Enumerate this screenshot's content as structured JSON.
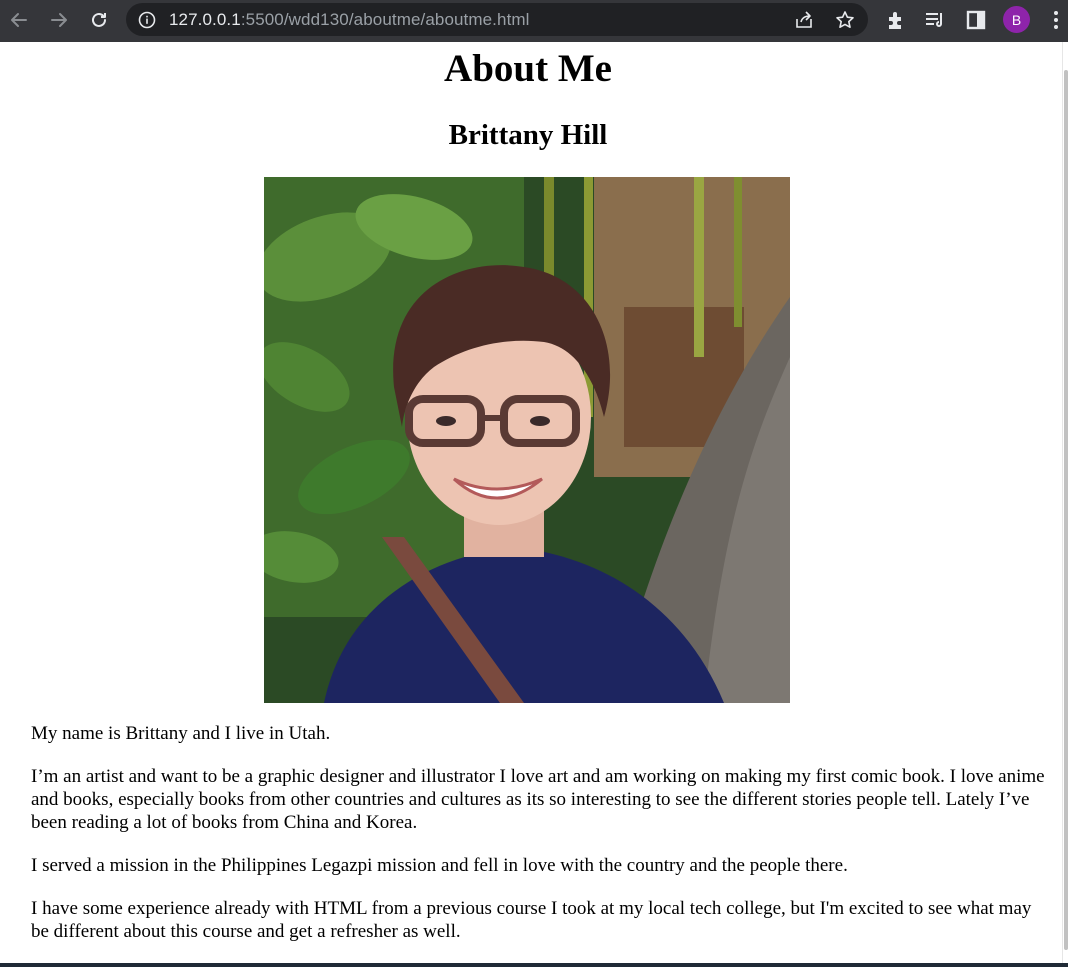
{
  "browser": {
    "url_host": "127.0.0.1",
    "url_rest": ":5500/wdd130/aboutme/aboutme.html",
    "profile_initial": "B"
  },
  "page": {
    "title": "About Me",
    "name": "Brittany Hill",
    "photo_alt": "",
    "paragraphs": [
      "My name is Brittany and I live in Utah.",
      "I’m an artist and want to be a graphic designer and illustrator I love art and am working on making my first comic book. I love anime and books, especially books from other countries and cultures as its so interesting to see the different stories people tell. Lately I’ve been reading a lot of books from China and Korea.",
      "I served a mission in the Philippines Legazpi mission and fell in love with the country and the people there.",
      "I have some experience already with HTML from a previous course I took at my local tech college, but I'm excited to see what may be different about this course and get a refresher as well."
    ]
  },
  "colors": {
    "chrome_bg": "#35363a",
    "omnibox_bg": "#202124",
    "avatar_bg": "#8e24aa"
  }
}
